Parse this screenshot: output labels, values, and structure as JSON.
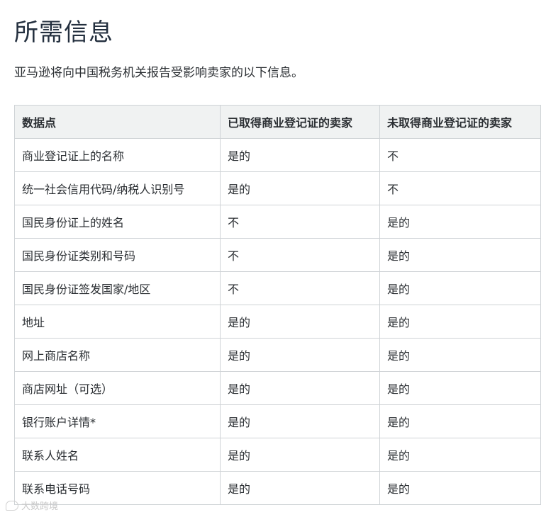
{
  "title": "所需信息",
  "intro": "亚马逊将向中国税务机关报告受影响卖家的以下信息。",
  "table": {
    "headers": [
      "数据点",
      "已取得商业登记证的卖家",
      "未取得商业登记证的卖家"
    ],
    "rows": [
      [
        "商业登记证上的名称",
        "是的",
        "不"
      ],
      [
        "统一社会信用代码/纳税人识别号",
        "是的",
        "不"
      ],
      [
        "国民身份证上的姓名",
        "不",
        "是的"
      ],
      [
        "国民身份证类别和号码",
        "不",
        "是的"
      ],
      [
        "国民身份证签发国家/地区",
        "不",
        "是的"
      ],
      [
        "地址",
        "是的",
        "是的"
      ],
      [
        "网上商店名称",
        "是的",
        "是的"
      ],
      [
        "商店网址（可选）",
        "是的",
        "是的"
      ],
      [
        "银行账户详情*",
        "是的",
        "是的"
      ],
      [
        "联系人姓名",
        "是的",
        "是的"
      ],
      [
        "联系电话号码",
        "是的",
        "是的"
      ]
    ]
  },
  "watermark": {
    "text": "大数跨境",
    "icon": "chat-bubble-icon"
  }
}
